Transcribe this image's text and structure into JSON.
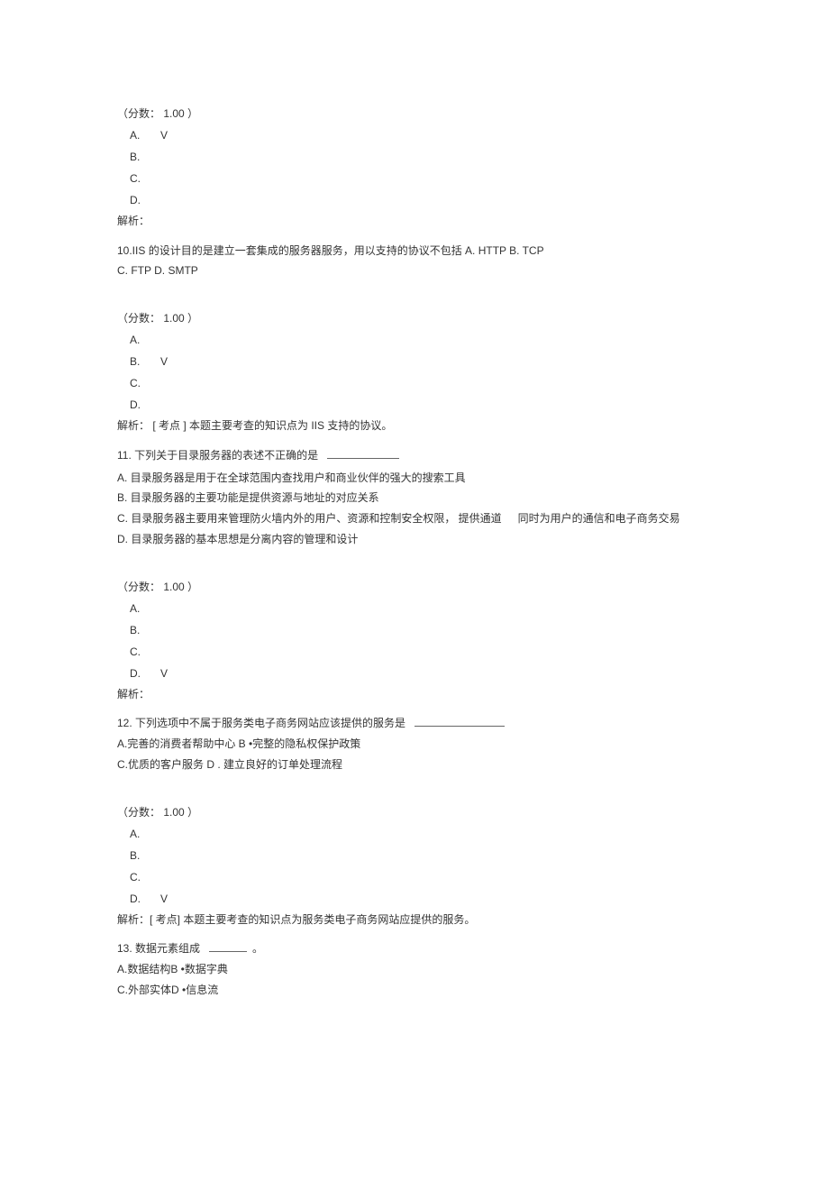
{
  "q9": {
    "score_label": "（分数：  1.00 ）",
    "opts": {
      "a": "A.",
      "b": "B.",
      "c": "C.",
      "d": "D."
    },
    "mark": "V",
    "analysis_label": "解析："
  },
  "q10": {
    "stem": "10.IIS 的设计目的是建立一套集成的服务器服务，用以支持的协议不包括  A.   HTTP B.  TCP",
    "stem2": "C.  FTP D.  SMTP",
    "score_label": "（分数：  1.00 ）",
    "opts": {
      "a": "A.",
      "b": "B.",
      "c": "C.",
      "d": "D."
    },
    "mark": "V",
    "analysis": "解析：  [ 考点 ] 本题主要考查的知识点为 IIS 支持的协议。"
  },
  "q11": {
    "stem": "11.  下列关于目录服务器的表述不正确的是",
    "a": "A.  目录服务器是用于在全球范围内查找用户和商业伙伴的强大的搜索工具",
    "b": "B.  目录服务器的主要功能是提供资源与地址的对应关系",
    "c": "C.  目录服务器主要用来管理防火墙内外的用户、资源和控制安全权限，  提供通道",
    "c_side": "同时为用户的通信和电子商务交易",
    "d": "D.  目录服务器的基本思想是分离内容的管理和设计",
    "score_label": "（分数：  1.00 ）",
    "opts": {
      "a": "A.",
      "b": "B.",
      "c": "C.",
      "d": "D."
    },
    "mark": "V",
    "analysis_label": "解析："
  },
  "q12": {
    "stem": "12.  下列选项中不属于服务类电子商务网站应该提供的服务是",
    "line1": "A.完善的消费者帮助中心  B •完整的隐私权保护政策",
    "line2": "C.优质的客户服务  D . 建立良好的订单处理流程",
    "score_label": "（分数：  1.00 ）",
    "opts": {
      "a": "A.",
      "b": "B.",
      "c": "C.",
      "d": "D."
    },
    "mark": "V",
    "analysis": "解析：[ 考点] 本题主要考查的知识点为服务类电子商务网站应提供的服务。"
  },
  "q13": {
    "stem": "13.  数据元素组成",
    "stem_suffix": "。",
    "line1": "A.数据结构B •数据字典",
    "line2": "C.外部实体D •信息流"
  }
}
